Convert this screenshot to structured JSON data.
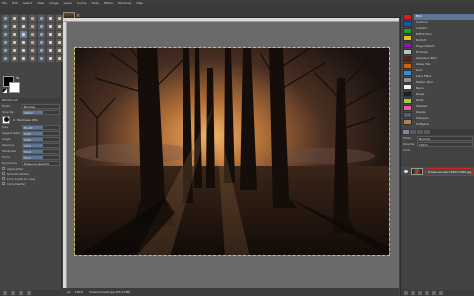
{
  "menubar": {
    "items": [
      "File",
      "Edit",
      "Select",
      "View",
      "Image",
      "Layer",
      "Colors",
      "Tools",
      "Filters",
      "Windows",
      "Help"
    ]
  },
  "toolbox": {
    "tool_count": 42,
    "fg_color": "#000000",
    "bg_color": "#ffffff",
    "options": {
      "title": "Paintbrush",
      "mode_label": "Mode",
      "mode_value": "Normal",
      "opacity_label": "Opacity",
      "opacity_value": "100.0",
      "brush_name": "2. Hardness 050",
      "size_label": "Size",
      "size_value": "51.00",
      "aspect_label": "Aspect Ratio",
      "aspect_value": "0.00",
      "angle_label": "Angle",
      "angle_value": "0.00",
      "spacing_label": "Spacing",
      "spacing_value": "10.0",
      "hardness_label": "Hardness",
      "hardness_value": "50.0",
      "force_label": "Force",
      "force_value": "50.0",
      "dynamics_label": "Dynamics",
      "dynamics_value": "Pressure Opacity",
      "checks": [
        {
          "label": "Apply Jitter",
          "on": false
        },
        {
          "label": "Smooth stroke",
          "on": false
        },
        {
          "label": "Lock brush to view",
          "on": false
        },
        {
          "label": "Incremental",
          "on": false
        }
      ]
    }
  },
  "status": {
    "unit": "px",
    "zoom": "100%",
    "text": "forest-sunset.jpg (63.4 MB)"
  },
  "right_dock": {
    "filters": [
      "Blur",
      "Cartoon",
      "Cubism",
      "Diffraction",
      "Distort",
      "Edge Detect",
      "Emboss",
      "Gaussian Blur",
      "Glass Tile",
      "Grid",
      "Lens Flare",
      "Motion Blur",
      "Neon",
      "Noise",
      "Oilify",
      "Pixelize",
      "Ripple",
      "Sharpen",
      "Softglow",
      "Supernova"
    ],
    "selected_filter_index": 0,
    "pattern_colors": [
      "#d02020",
      "#2050c0",
      "#20a030",
      "#e0c020",
      "#8020a0",
      "#c0c0c0",
      "#602010",
      "#d06010",
      "#3090d0",
      "#909090",
      "#f0f0f0",
      "#202020",
      "#a0d040",
      "#e060a0",
      "#506070",
      "#b08050"
    ],
    "layers": {
      "mode_label": "Mode",
      "mode_value": "Normal",
      "opacity_label": "Opacity",
      "opacity_value": "100.0",
      "lock_label": "Lock:",
      "layer_name": "forest-sunset-1920x1280.jpg"
    }
  }
}
